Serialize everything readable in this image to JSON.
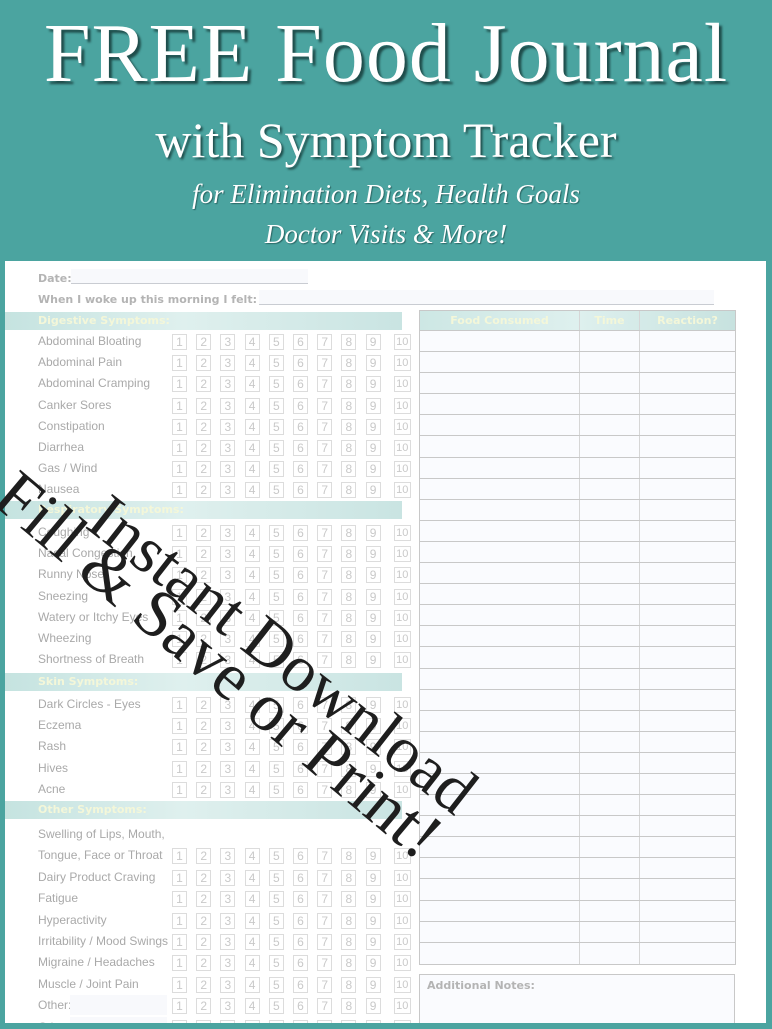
{
  "banner": {
    "title": "FREE Food Journal",
    "subtitle": "with Symptom Tracker",
    "tagline_line1": "for Elimination Diets, Health Goals",
    "tagline_line2": "Doctor Visits & More!"
  },
  "colors": {
    "teal": "#4ba4a0",
    "section_bar": "#cfe8e5",
    "section_text": "#f4f7d9",
    "label_text": "#a9a9a9"
  },
  "form": {
    "date_label": "Date:",
    "woke_label": "When I woke up this morning I felt:",
    "scale": [
      "1",
      "2",
      "3",
      "4",
      "5",
      "6",
      "7",
      "8",
      "9",
      "10"
    ],
    "sections": [
      {
        "title": "Digestive Symptoms:",
        "items": [
          "Abdominal Bloating",
          "Abdominal Pain",
          "Abdominal Cramping",
          "Canker Sores",
          "Constipation",
          "Diarrhea",
          "Gas / Wind",
          "Nausea"
        ]
      },
      {
        "title": "Respiratory Symptoms:",
        "items": [
          "Coughing",
          "Nasal Congestion",
          "Runny Nose",
          "Sneezing",
          "Watery or Itchy Eyes",
          "Wheezing",
          "Shortness of Breath"
        ]
      },
      {
        "title": "Skin Symptoms:",
        "items": [
          "Dark Circles - Eyes",
          "Eczema",
          "Rash",
          "Hives",
          "Acne"
        ]
      },
      {
        "title": "Other Symptoms:",
        "items": [
          "Swelling of Lips, Mouth,",
          "Tongue, Face or Throat",
          "Dairy Product Craving",
          "Fatigue",
          "Hyperactivity",
          "Irritability / Mood Swings",
          "Migraine / Headaches",
          "Muscle / Joint Pain",
          "Other:",
          "Other:"
        ]
      }
    ]
  },
  "food_table": {
    "headers": [
      "Food Consumed",
      "Time",
      "Reaction?"
    ],
    "row_count": 30
  },
  "notes": {
    "label": "Additional Notes:"
  },
  "overlay": {
    "line1": "Instant Download",
    "line2": "Fill & Save or Print!"
  }
}
